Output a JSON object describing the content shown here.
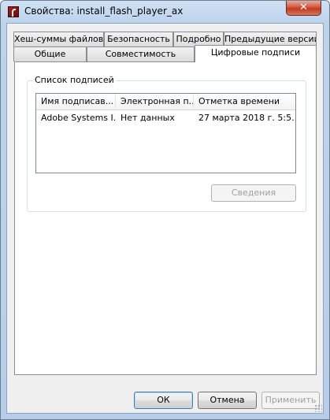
{
  "window": {
    "title": "Свойства: install_flash_player_ax",
    "close_label": "✕"
  },
  "tabs_top": [
    {
      "label": "Хеш-суммы файлов"
    },
    {
      "label": "Безопасность"
    },
    {
      "label": "Подробно"
    },
    {
      "label": "Предыдущие версии"
    }
  ],
  "tabs_bottom": [
    {
      "label": "Общие"
    },
    {
      "label": "Совместимость"
    },
    {
      "label": "Цифровые подписи"
    }
  ],
  "signatures": {
    "group_label": "Список подписей",
    "columns": [
      "Имя подписав...",
      "Электронная п...",
      "Отметка времени"
    ],
    "rows": [
      [
        "Adobe Systems I...",
        "Нет данных",
        "27 марта 2018 г. 5:5..."
      ]
    ],
    "details_button": "Сведения"
  },
  "footer": {
    "ok": "ОК",
    "cancel": "Отмена",
    "apply": "Применить"
  }
}
